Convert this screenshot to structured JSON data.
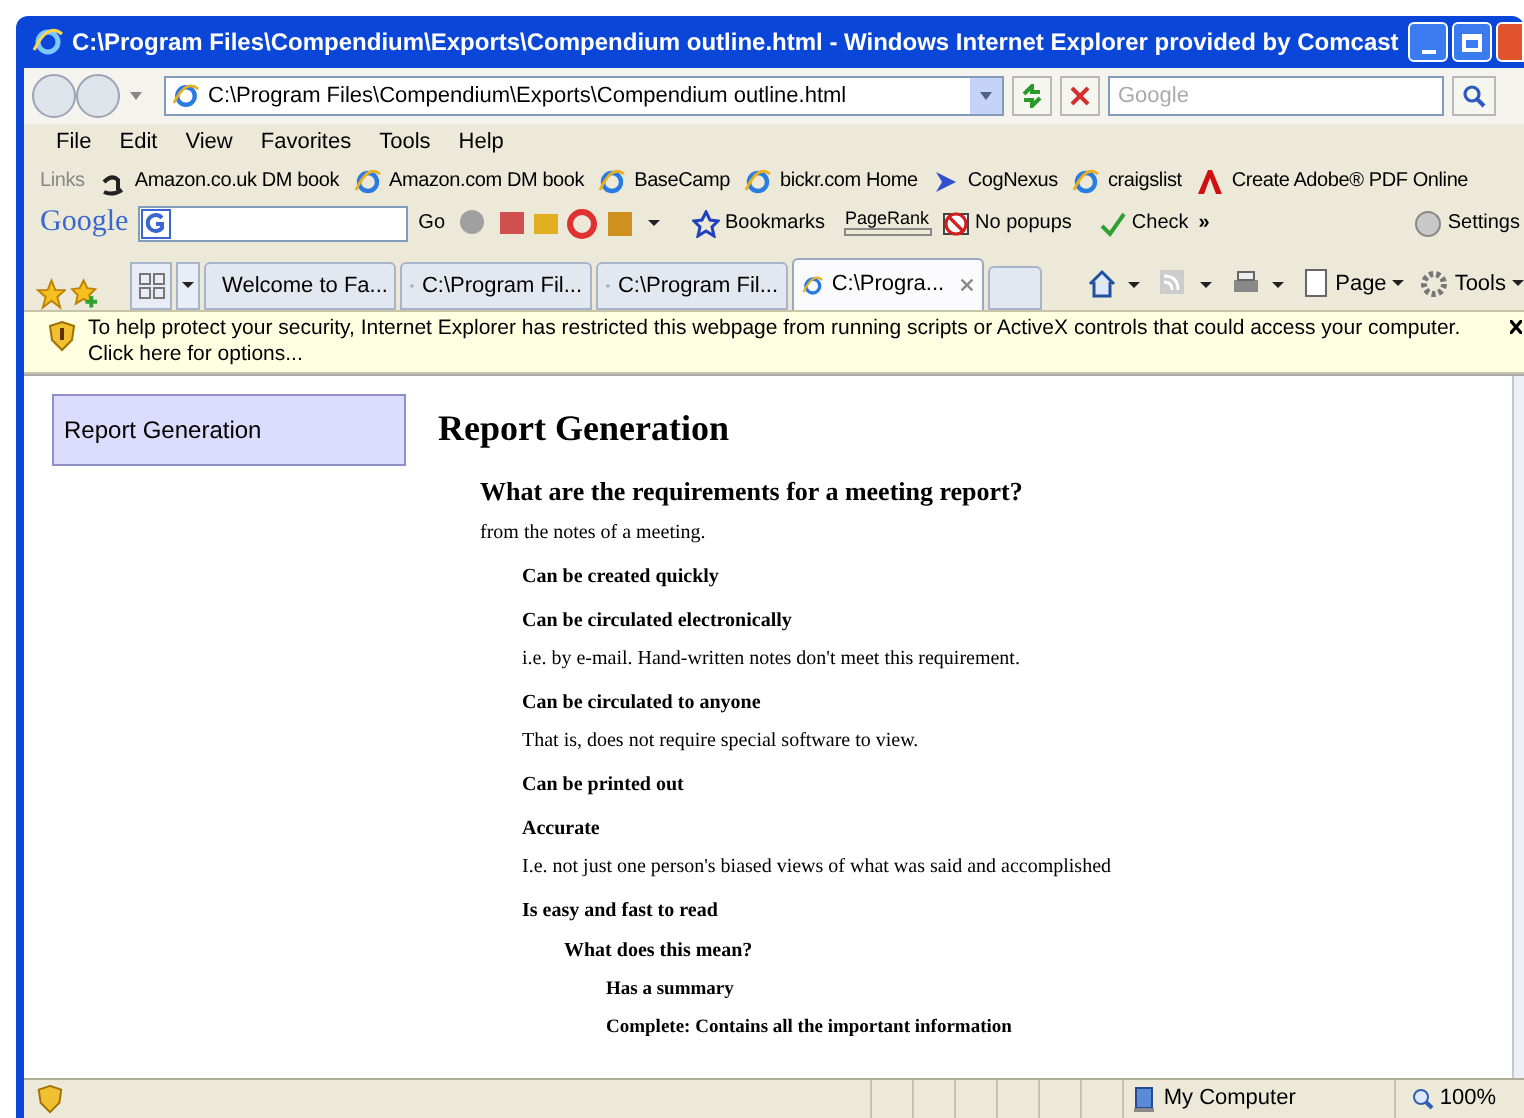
{
  "window": {
    "title": "C:\\Program Files\\Compendium\\Exports\\Compendium outline.html - Windows Internet Explorer provided by Comcast"
  },
  "address_bar": {
    "value": "C:\\Program Files\\Compendium\\Exports\\Compendium outline.html"
  },
  "search": {
    "placeholder": "Google"
  },
  "menu": [
    "File",
    "Edit",
    "View",
    "Favorites",
    "Tools",
    "Help"
  ],
  "links_bar": {
    "label": "Links",
    "items": [
      {
        "label": "Amazon.co.uk DM book",
        "kind": "amazon"
      },
      {
        "label": "Amazon.com DM book",
        "kind": "ie"
      },
      {
        "label": "BaseCamp",
        "kind": "ie"
      },
      {
        "label": "bickr.com Home",
        "kind": "ie"
      },
      {
        "label": "CogNexus",
        "kind": "arrow"
      },
      {
        "label": "craigslist",
        "kind": "ie"
      },
      {
        "label": "Create Adobe® PDF Online",
        "kind": "adobe"
      }
    ]
  },
  "google_toolbar": {
    "logo": "Google",
    "go": "Go",
    "bookmarks": "Bookmarks",
    "pagerank": "PageRank",
    "popups": "No popups",
    "check": "Check",
    "more": "»",
    "settings": "Settings"
  },
  "tabs": [
    {
      "label": "Welcome to Fa...",
      "kind": "facebook",
      "selected": false
    },
    {
      "label": "C:\\Program Fil...",
      "kind": "ie",
      "selected": false
    },
    {
      "label": "C:\\Program Fil...",
      "kind": "ie",
      "selected": false
    },
    {
      "label": "C:\\Progra...",
      "kind": "ie",
      "selected": true
    }
  ],
  "command_bar": {
    "page": "Page",
    "tools": "Tools"
  },
  "info_bar": {
    "text": "To help protect your security, Internet Explorer has restricted this webpage from running scripts or ActiveX controls that could access your computer. Click here for options..."
  },
  "sidebar": {
    "items": [
      {
        "label": "Report Generation",
        "selected": true
      }
    ]
  },
  "outline": {
    "title": "Report Generation",
    "children": [
      {
        "title": "What are the requirements for a meeting report?",
        "note": "from the notes of a meeting.",
        "children": [
          {
            "title": "Can be created quickly"
          },
          {
            "title": "Can be circulated electronically",
            "note": "i.e. by e-mail. Hand-written notes don't meet this requirement."
          },
          {
            "title": "Can be circulated to anyone",
            "note": "That is, does not require special software to view."
          },
          {
            "title": "Can be printed out"
          },
          {
            "title": "Accurate",
            "note": "I.e. not just one person's biased views of what was said and accomplished"
          },
          {
            "title": "Is easy and fast to read",
            "children": [
              {
                "title": "What does this mean?",
                "children": [
                  {
                    "title": "Has a summary"
                  },
                  {
                    "title": "Complete: Contains all the important information"
                  }
                ]
              }
            ]
          }
        ]
      }
    ]
  },
  "status_bar": {
    "zone": "My Computer",
    "zoom": "100%"
  }
}
